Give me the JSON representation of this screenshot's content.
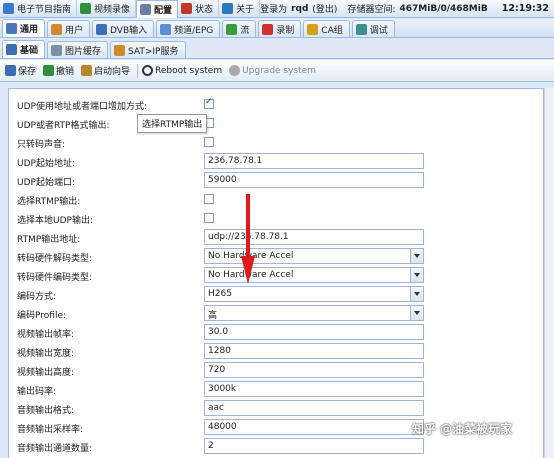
{
  "top_nav": [
    {
      "label": "电子节目指南",
      "icon": "epg-icon",
      "color": "#3a7bd5"
    },
    {
      "label": "视频录像",
      "icon": "video-record-icon",
      "color": "#2f8f3a"
    },
    {
      "label": "配置",
      "icon": "config-icon",
      "color": "#6a7fa8",
      "active": true
    },
    {
      "label": "状态",
      "icon": "status-icon",
      "color": "#c0392b"
    },
    {
      "label": "关于",
      "icon": "about-icon",
      "color": "#2b78c2"
    }
  ],
  "status": {
    "login_prefix": "登录为",
    "user": "rqd",
    "logout": "(登出)",
    "storage_label": "存储器空间:",
    "storage_value": "467MiB/0/468MiB",
    "clock": "12:19:32"
  },
  "main_tabs": [
    {
      "label": "通用",
      "icon": "wrench-icon",
      "color": "#4a78b8",
      "active": true
    },
    {
      "label": "用户",
      "icon": "user-icon",
      "color": "#d08a2b"
    },
    {
      "label": "DVB输入",
      "icon": "dvb-icon",
      "color": "#3a6fb5"
    },
    {
      "label": "频道/EPG",
      "icon": "channel-icon",
      "color": "#5a8fd5"
    },
    {
      "label": "流",
      "icon": "stream-icon",
      "color": "#3d9b3d"
    },
    {
      "label": "录制",
      "icon": "record-icon",
      "color": "#d32f2f"
    },
    {
      "label": "CA组",
      "icon": "key-icon",
      "color": "#d4a017"
    },
    {
      "label": "调试",
      "icon": "debug-icon",
      "color": "#3a8f8f"
    }
  ],
  "sub_tabs": [
    {
      "label": "基础",
      "icon": "base-icon",
      "color": "#3a6fb5",
      "active": true
    },
    {
      "label": "图片缓存",
      "icon": "image-cache-icon",
      "color": "#7a8fa8"
    },
    {
      "label": "SAT>IP服务",
      "icon": "satip-icon",
      "color": "#d08a2b"
    }
  ],
  "toolbar": [
    {
      "label": "保存",
      "icon": "save-icon",
      "color": "#3a6fb5"
    },
    {
      "label": "撤销",
      "icon": "undo-icon",
      "color": "#2f8f3a"
    },
    {
      "label": "启动向导",
      "icon": "wizard-icon",
      "color": "#b8862b"
    },
    {
      "label": "Reboot system",
      "icon": "reboot-icon",
      "color": "#333333"
    },
    {
      "label": "Upgrade system",
      "icon": "upgrade-icon",
      "color": "#aaaaaa",
      "disabled": true
    }
  ],
  "form_rows": [
    {
      "label": "UDP使用地址或者端口增加方式:",
      "type": "checkbox",
      "checked": true
    },
    {
      "label": "UDP或者RTP格式输出:",
      "type": "checkbox",
      "checked": false
    },
    {
      "label": "只转码声音:",
      "type": "checkbox",
      "checked": false
    },
    {
      "label": "UDP起始地址:",
      "type": "text",
      "value": "236.78.78.1"
    },
    {
      "label": "UDP起始端口:",
      "type": "text",
      "value": "59000"
    },
    {
      "label": "选择RTMP输出:",
      "type": "checkbox",
      "checked": false
    },
    {
      "label": "选择本地UDP输出:",
      "type": "checkbox",
      "checked": false
    },
    {
      "label": "RTMP输出地址:",
      "type": "text",
      "value": "udp://236.78.78.1"
    },
    {
      "label": "转码硬件解码类型:",
      "type": "select",
      "value": "No Hardware Accel"
    },
    {
      "label": "转码硬件编码类型:",
      "type": "select",
      "value": "No Hardware Accel"
    },
    {
      "label": "编码方式:",
      "type": "select",
      "value": "H265"
    },
    {
      "label": "编码Profile:",
      "type": "select",
      "value": "高"
    },
    {
      "label": "视频输出帧率:",
      "type": "text",
      "value": "30.0"
    },
    {
      "label": "视频输出宽度:",
      "type": "text",
      "value": "1280"
    },
    {
      "label": "视频输出高度:",
      "type": "text",
      "value": "720"
    },
    {
      "label": "输出码率:",
      "type": "text",
      "value": "3000k"
    },
    {
      "label": "音频输出格式:",
      "type": "text",
      "value": "aac"
    },
    {
      "label": "音频输出采样率:",
      "type": "text",
      "value": "48000"
    },
    {
      "label": "音频输出通道数量:",
      "type": "text",
      "value": "2"
    }
  ],
  "tooltip": "选择RTMP输出",
  "watermark": "知乎 @油菜被玩家",
  "colors": {
    "accent": "#99bbe8",
    "arrow": "#e01a1a"
  }
}
